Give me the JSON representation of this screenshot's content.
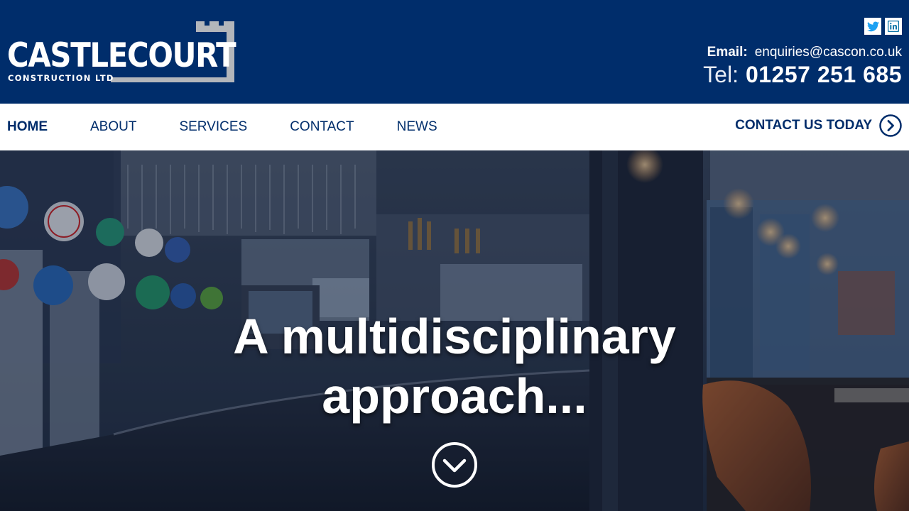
{
  "brand": {
    "name": "CASTLECOURT",
    "subtitle": "CONSTRUCTION LTD"
  },
  "header": {
    "social": [
      {
        "icon": "twitter-icon",
        "color": "#1da1f2"
      },
      {
        "icon": "linkedin-icon",
        "color": "#0e76a8"
      }
    ],
    "email_label": "Email:",
    "email": "enquiries@cascon.co.uk",
    "phone_label": "Tel:",
    "phone": "01257 251 685"
  },
  "nav": {
    "items": [
      {
        "label": "HOME",
        "active": true
      },
      {
        "label": "ABOUT",
        "active": false
      },
      {
        "label": "SERVICES",
        "active": false
      },
      {
        "label": "CONTACT",
        "active": false
      },
      {
        "label": "NEWS",
        "active": false
      }
    ],
    "cta_label": "CONTACT US TODAY",
    "cta_icon": "chevron-right-circle-icon"
  },
  "hero": {
    "title": "A multidisciplinary approach...",
    "scroll_icon": "chevron-down-circle-icon",
    "image_description": "bar-interior-photo"
  },
  "colors": {
    "brand_blue": "#002d6b",
    "logo_grey": "#b3b6bb",
    "white": "#ffffff"
  }
}
